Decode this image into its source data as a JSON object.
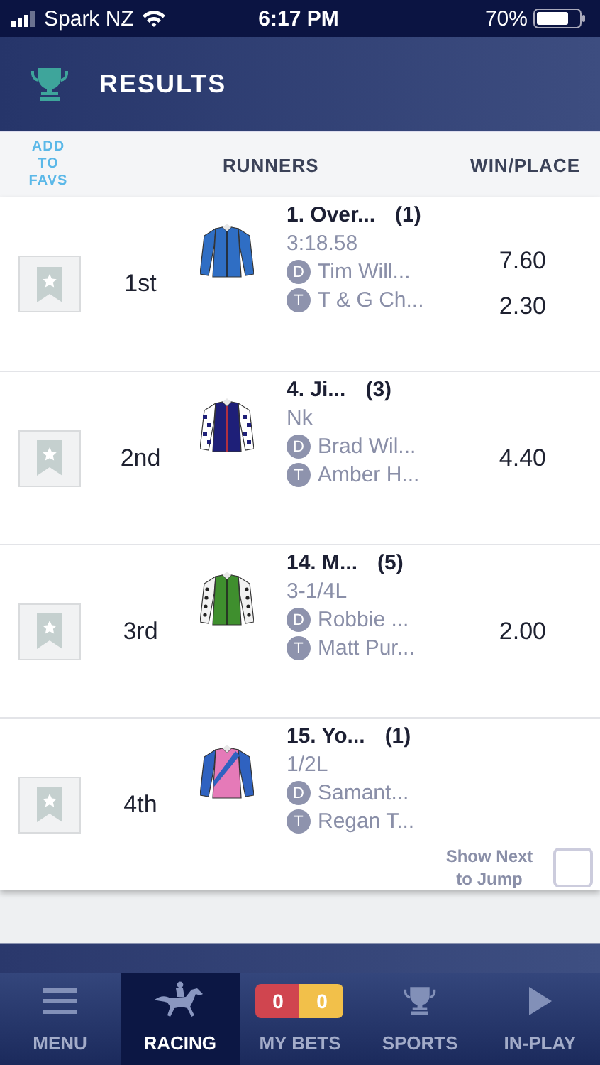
{
  "status_bar": {
    "carrier": "Spark NZ",
    "time": "6:17 PM",
    "battery": "70%"
  },
  "header": {
    "title": "RESULTS"
  },
  "columns": {
    "favs": "ADD TO FAVS",
    "runners": "RUNNERS",
    "odds": "WIN/PLACE"
  },
  "runners": [
    {
      "place": "1st",
      "name": "1. Over...",
      "barrier": "(1)",
      "margin": "3:18.58",
      "driver_badge": "D",
      "driver": "Tim Will...",
      "trainer_badge": "T",
      "trainer": "T & G Ch...",
      "odds": [
        "7.60",
        "2.30"
      ],
      "kind": "plain",
      "color": "#2f6ec4"
    },
    {
      "place": "2nd",
      "name": "4. Ji...",
      "barrier": "(3)",
      "margin": "Nk",
      "driver_badge": "D",
      "driver": "Brad Wil...",
      "trainer_badge": "T",
      "trainer": "Amber H...",
      "odds": [
        "4.40"
      ],
      "kind": "checked",
      "color": "#1e1f78"
    },
    {
      "place": "3rd",
      "name": "14. M...",
      "barrier": "(5)",
      "margin": "3-1/4L",
      "driver_badge": "D",
      "driver": "Robbie ...",
      "trainer_badge": "T",
      "trainer": "Matt Pur...",
      "odds": [
        "2.00"
      ],
      "kind": "spotted",
      "color": "#3f8f2e"
    },
    {
      "place": "4th",
      "name": "15. Yo...",
      "barrier": "(1)",
      "margin": "1/2L",
      "driver_badge": "D",
      "driver": "Samant...",
      "trainer_badge": "T",
      "trainer": "Regan T...",
      "kind": "sash",
      "color": "#e57ab8"
    }
  ],
  "next_to_jump": {
    "label": "Show Next to Jump",
    "checked": false
  },
  "tabs": [
    {
      "kind": "menu",
      "label": "MENU",
      "selected": false
    },
    {
      "kind": "racing",
      "label": "RACING",
      "selected": true
    },
    {
      "kind": "bets",
      "label": "MY BETS",
      "selected": false,
      "counts": [
        {
          "value": "0",
          "color": "#d0454f"
        },
        {
          "value": "0",
          "color": "#f2c04a"
        }
      ]
    },
    {
      "kind": "sports",
      "label": "SPORTS",
      "selected": false
    },
    {
      "kind": "inplay",
      "label": "IN-PLAY",
      "selected": false
    }
  ]
}
